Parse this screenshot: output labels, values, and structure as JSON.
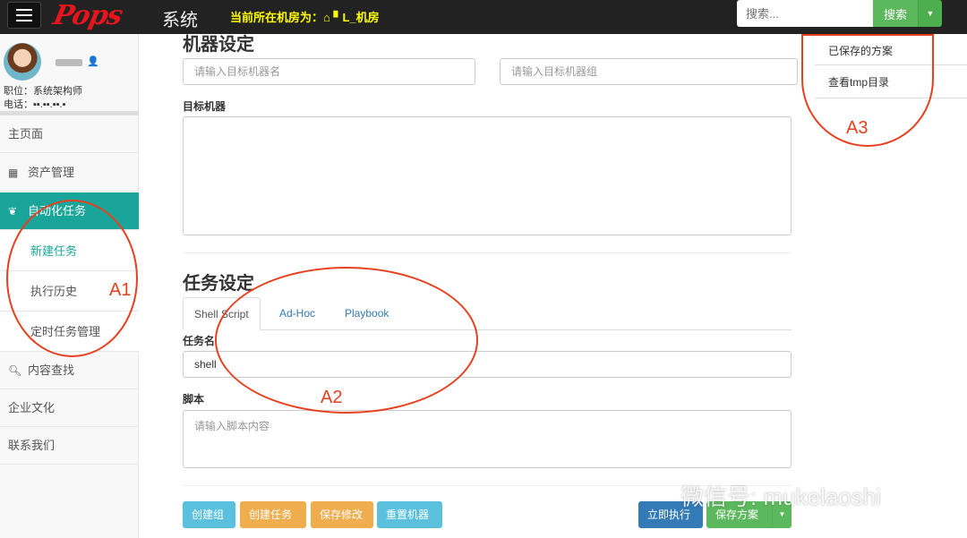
{
  "topbar": {
    "logo": "Pops",
    "system": "系统",
    "room_label": "当前所在机房为：",
    "room_name": "▘L_机房",
    "search_placeholder": "搜索...",
    "search_button": "搜索"
  },
  "user": {
    "position": "职位：系统架构师",
    "phone": "电话：▪▪.▪▪.▪▪.▪"
  },
  "sidebar": {
    "items": [
      {
        "label": "主页面"
      },
      {
        "label": "资产管理"
      },
      {
        "label": "自动化任务"
      },
      {
        "label": "新建任务"
      },
      {
        "label": "执行历史"
      },
      {
        "label": "定时任务管理"
      },
      {
        "label": "内容查找"
      },
      {
        "label": "企业文化"
      },
      {
        "label": "联系我们"
      }
    ]
  },
  "machine": {
    "title": "机器设定",
    "name_placeholder": "请输入目标机器名",
    "group_placeholder": "请输入目标机器组",
    "target_label": "目标机器"
  },
  "task": {
    "title": "任务设定",
    "tabs": [
      "Shell Script",
      "Ad-Hoc",
      "Playbook"
    ],
    "name_label": "任务名",
    "name_value": "shell",
    "script_label": "脚本",
    "script_placeholder": "请输入脚本内容"
  },
  "buttons": {
    "create_group": "创建组",
    "create_task": "创建任务",
    "save_changes": "保存修改",
    "reset_machine": "重置机器",
    "run_now": "立即执行",
    "save_plan": "保存方案"
  },
  "right": {
    "saved_plans": "已保存的方案",
    "view_tmp": "查看tmp目录"
  },
  "annotations": {
    "a1": "A1",
    "a2": "A2",
    "a3": "A3"
  },
  "watermark": "微信号: mukelaoshi"
}
